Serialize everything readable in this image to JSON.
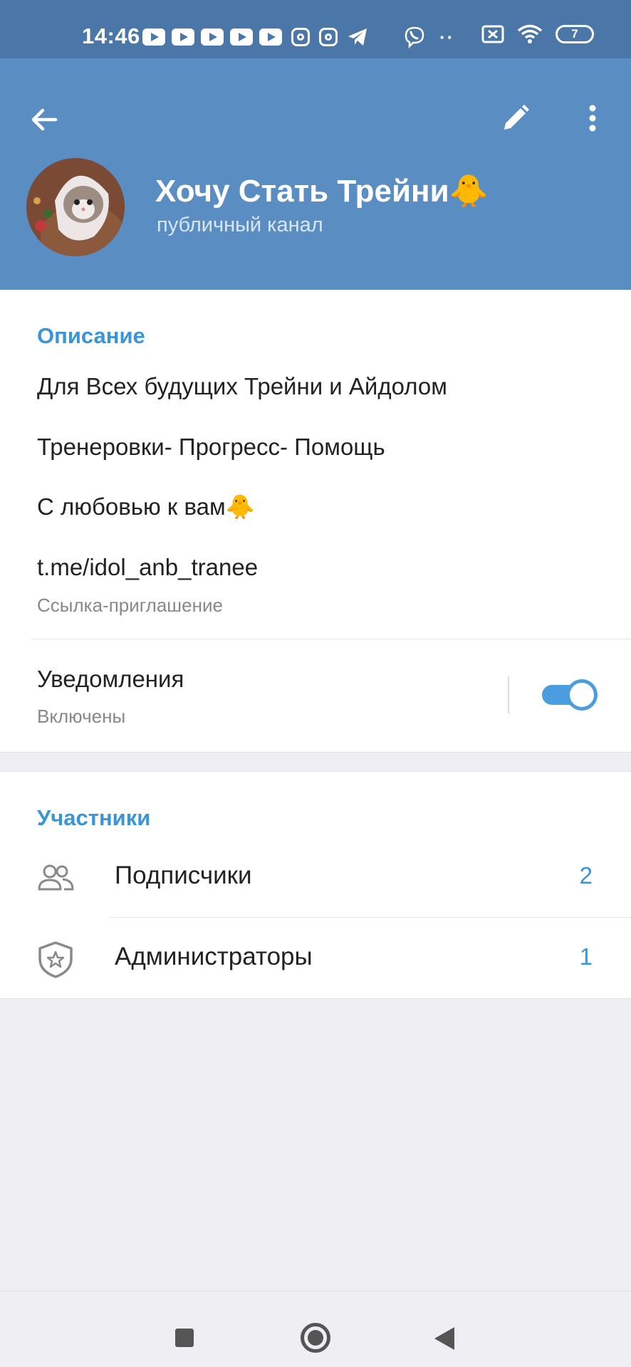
{
  "status_bar": {
    "time": "14:46",
    "battery": "7"
  },
  "header": {
    "title": "Хочу Стать Трейни🐥",
    "subtitle": "публичный канал",
    "icons": [
      "back-arrow-icon",
      "pencil-icon",
      "more-vertical-icon"
    ]
  },
  "info": {
    "section_title": "Описание",
    "description_lines": [
      "Для Всех будущих Трейни и Айдолом",
      "Тренеровки- Прогресс- Помощь",
      "С любовью к вам🐥"
    ],
    "link": "t.me/idol_anb_tranee",
    "link_caption": "Ссылка-приглашение",
    "notifications_label": "Уведомления",
    "notifications_status": "Включены",
    "notifications_enabled": true
  },
  "members": {
    "section_title": "Участники",
    "rows": [
      {
        "label": "Подписчики",
        "count": "2",
        "icon": "people-icon"
      },
      {
        "label": "Администраторы",
        "count": "1",
        "icon": "shield-star-icon"
      }
    ]
  },
  "colors": {
    "header_bg": "#5a8ec3",
    "status_bg": "#4a76a8",
    "accent": "#3a95d8",
    "page_bg": "#efeff3"
  }
}
